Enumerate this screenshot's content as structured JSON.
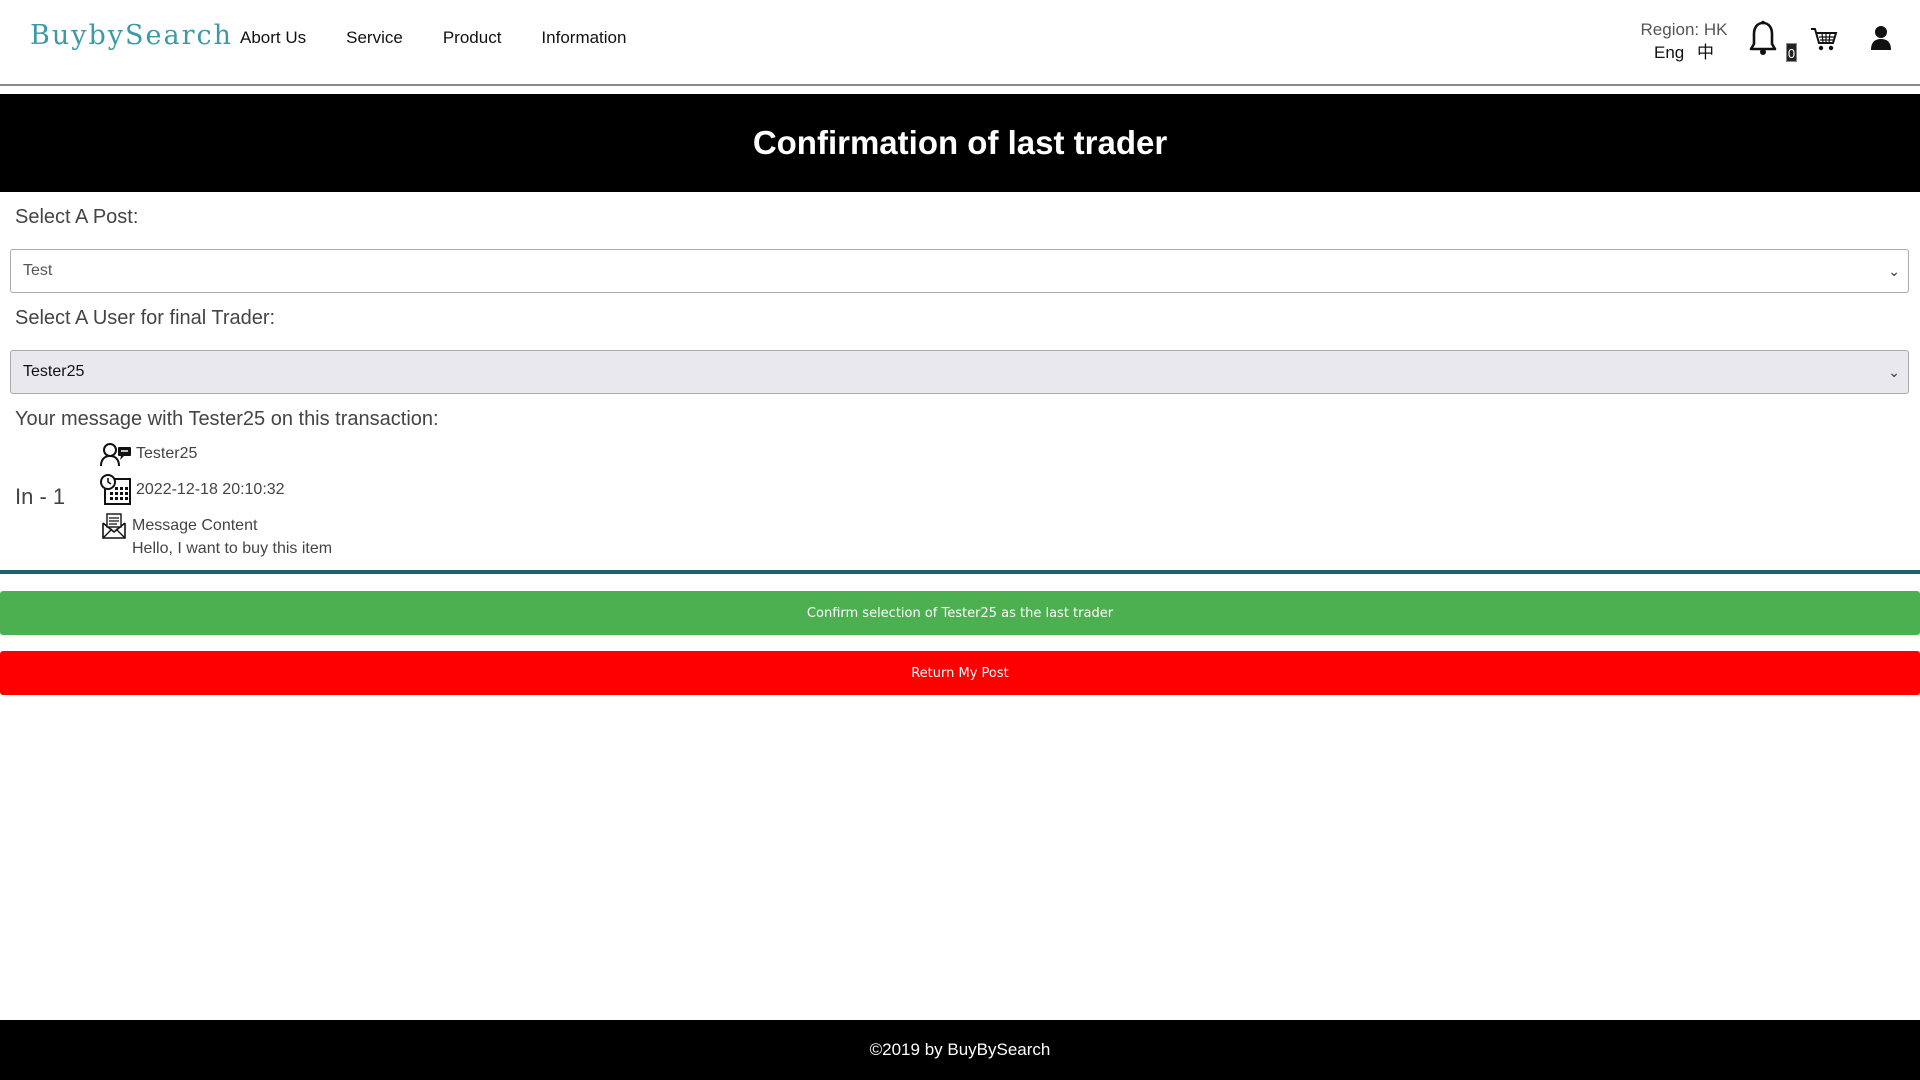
{
  "header": {
    "logo": "BuybySearch",
    "nav": [
      "Abort Us",
      "Service",
      "Product",
      "Information"
    ],
    "region": "Region: HK",
    "lang_en": "Eng",
    "lang_zh": "中",
    "notification_count": "0"
  },
  "page": {
    "title": "Confirmation of last trader"
  },
  "form": {
    "post_label": "Select A Post:",
    "post_value": "Test",
    "user_label": "Select A User for final Trader:",
    "user_value": "Tester25",
    "message_label": "Your message with Tester25 on this transaction:"
  },
  "message": {
    "index": "In - 1",
    "sender": "Tester25",
    "timestamp": "2022-12-18 20:10:32",
    "content_label": "Message Content",
    "content": "Hello, I want to buy this item"
  },
  "buttons": {
    "confirm": "Confirm selection of Tester25 as the last trader",
    "return": "Return My Post"
  },
  "footer": {
    "copyright": "©2019 by BuyBySearch"
  },
  "colors": {
    "logo": "#3a9aa5",
    "confirm": "#4caf50",
    "return": "#ff0000",
    "divider": "#1e6168"
  }
}
